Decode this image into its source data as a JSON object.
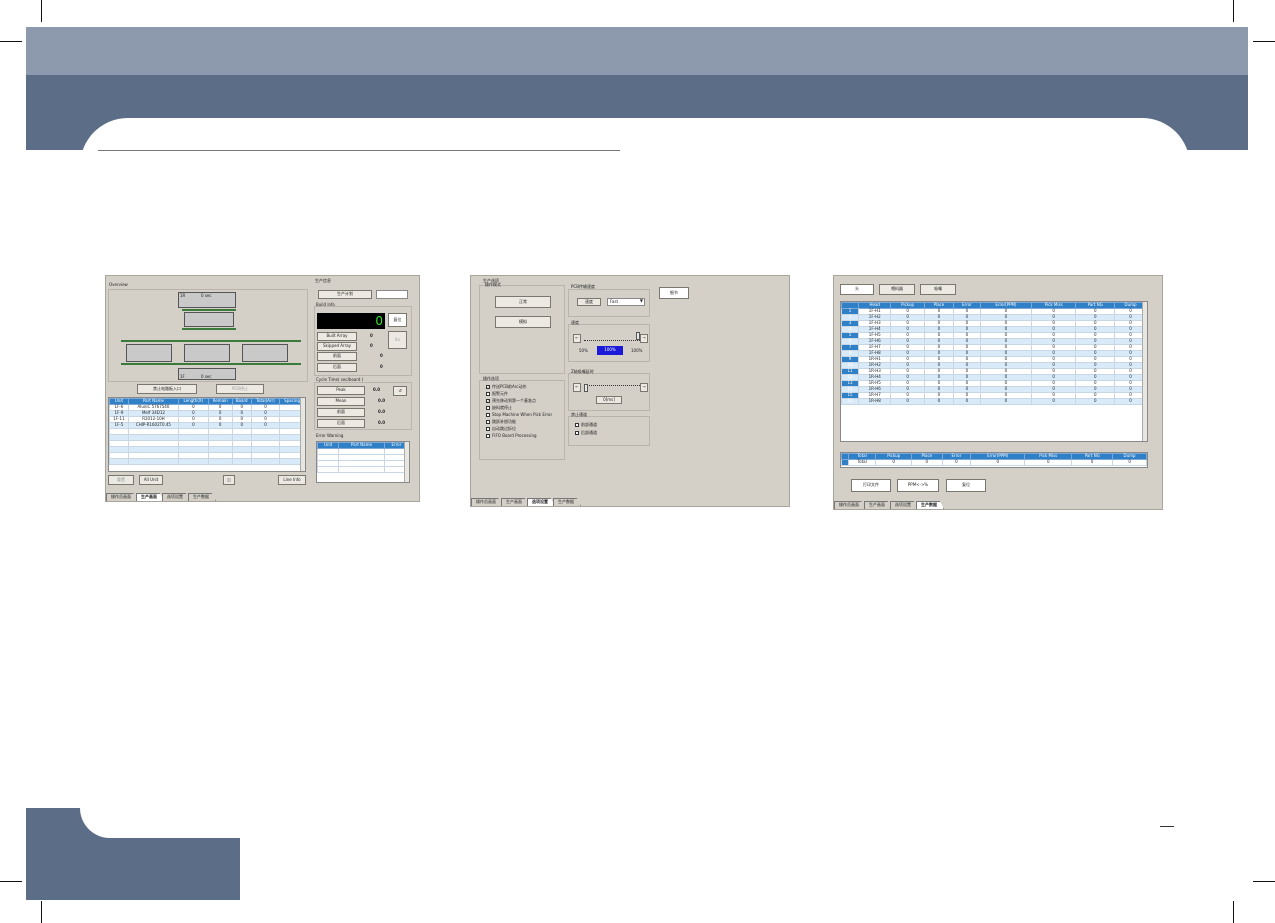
{
  "screens": {
    "production": {
      "overview_label": "Overview",
      "top_unit_label": "1R",
      "top_unit_time": "0 sec",
      "bottom_unit_label": "1F",
      "bottom_unit_time": "0 sec",
      "btn_stop_entrance": "禁止电路板入口",
      "btn_pcb_stop": "PCB停止",
      "parts_columns": [
        "Unit",
        "Part Name",
        "Length(X)",
        "Remain",
        "Board",
        "Total(Arr)",
        "Spacing"
      ],
      "parts_rows": [
        [
          "1F-6",
          "AluniC 5767540",
          "0",
          "0",
          "0",
          "0",
          ""
        ],
        [
          "1F-9",
          "Melf 34D12",
          "0",
          "0",
          "0",
          "0",
          ""
        ],
        [
          "1F-11",
          "R2012-10H",
          "0",
          "0",
          "0",
          "0",
          ""
        ],
        [
          "1F-5",
          "CHIP-R1602T0.45",
          "0",
          "0",
          "0",
          "0",
          ""
        ]
      ],
      "btn_left": "重置",
      "btn_all_unit": "All Unit",
      "btn_line_info": "Line Info",
      "plan_title": "生产信息",
      "plan_btn": "生产计划",
      "build_info_title": "Build Info",
      "counter_value": "0",
      "btn_reset": "复位",
      "btn_disabled": "Bo",
      "built_array_label": "Built Array",
      "built_array_value": "0",
      "skipped_array_label": "Skipped Array",
      "skipped_array_value": "0",
      "front_label": "前面",
      "front_value": "0",
      "rear_label": "后面",
      "rear_value": "0",
      "cycle_title": "Cycle Time( sec/board )",
      "peak_label": "Peak",
      "peak_value": "0.0",
      "mean_label": "Mean",
      "mean_value": "0.0",
      "front2_label": "前面",
      "front2_value": "0.0",
      "rear2_label": "后面",
      "rear2_value": "0.0",
      "error_title": "Error Warning",
      "error_columns": [
        "Unit",
        "Part Name",
        "Error"
      ]
    },
    "options": {
      "group_title": "生产选项",
      "mode_title": "操作模式",
      "btn_normal": "正常",
      "btn_simulate": "模拟",
      "pcb_speed_title": "PCB传输速度",
      "speed_label": "速度",
      "speed_value": "Fast",
      "btn_detail": "细节",
      "speed2_title": "速度",
      "slider_min": "50%",
      "slider_value": "100%",
      "slider_max": "100%",
      "axis_title": "Z轴吸嘴延时",
      "axis_value": "0[ms]",
      "op_title": "操作选项",
      "checks": [
        "传送PCB前Arc动作",
        "报警元件",
        "预先移动到第一个基准点",
        "缺料就停止",
        "Stop Machine When Pick Error",
        "跳跃补偿功能",
        "自动跳过拆位",
        "FIFO Board Processing"
      ],
      "checks_state": [
        true,
        false,
        true,
        false,
        false,
        false,
        false,
        false
      ],
      "disable_title": "禁止通道",
      "disable_checks": [
        "前部通道",
        "后部通道"
      ]
    },
    "data": {
      "btn_head": "头",
      "btn_feeder": "喂料器",
      "btn_nozzle": "吸嘴",
      "columns": [
        "Head",
        "Pickup",
        "Place",
        "Error",
        "Error(PPM)",
        "Pick Miss",
        "Part NG",
        "Dump"
      ],
      "rows": [
        [
          "1",
          "1F-H1"
        ],
        [
          "2",
          "1F-H2"
        ],
        [
          "3",
          "1F-H3"
        ],
        [
          "4",
          "1F-H4"
        ],
        [
          "5",
          "1F-H5"
        ],
        [
          "6",
          "1F-H6"
        ],
        [
          "7",
          "1F-H7"
        ],
        [
          "8",
          "1F-H8"
        ],
        [
          "9",
          "1R-H1"
        ],
        [
          "10",
          "1R-H2"
        ],
        [
          "11",
          "1R-H3"
        ],
        [
          "12",
          "1R-H4"
        ],
        [
          "13",
          "1R-H5"
        ],
        [
          "14",
          "1R-H6"
        ],
        [
          "15",
          "1R-H7"
        ],
        [
          "16",
          "1R-H8"
        ]
      ],
      "row_values": [
        "0",
        "0",
        "0",
        "0",
        "0",
        "0",
        "0"
      ],
      "total_columns": [
        "Total",
        "Pickup",
        "Place",
        "Error",
        "Error(PPM)",
        "Pick Miss",
        "Part NG",
        "Dump"
      ],
      "total_row": [
        "Total",
        "0",
        "0",
        "0",
        "0",
        "0",
        "0",
        "0"
      ],
      "btn_print": "打印文件",
      "btn_ppm": "PPM<->%",
      "btn_reset": "复位"
    }
  },
  "tabs": [
    "操作员画面",
    "生产画面",
    "选项设置",
    "生产数据"
  ],
  "colors": {
    "band_light": "#8d99ad",
    "band_dark": "#5c6d88",
    "grid_header": "#2f80c6",
    "grid_alt_row": "#d9eaf8"
  }
}
